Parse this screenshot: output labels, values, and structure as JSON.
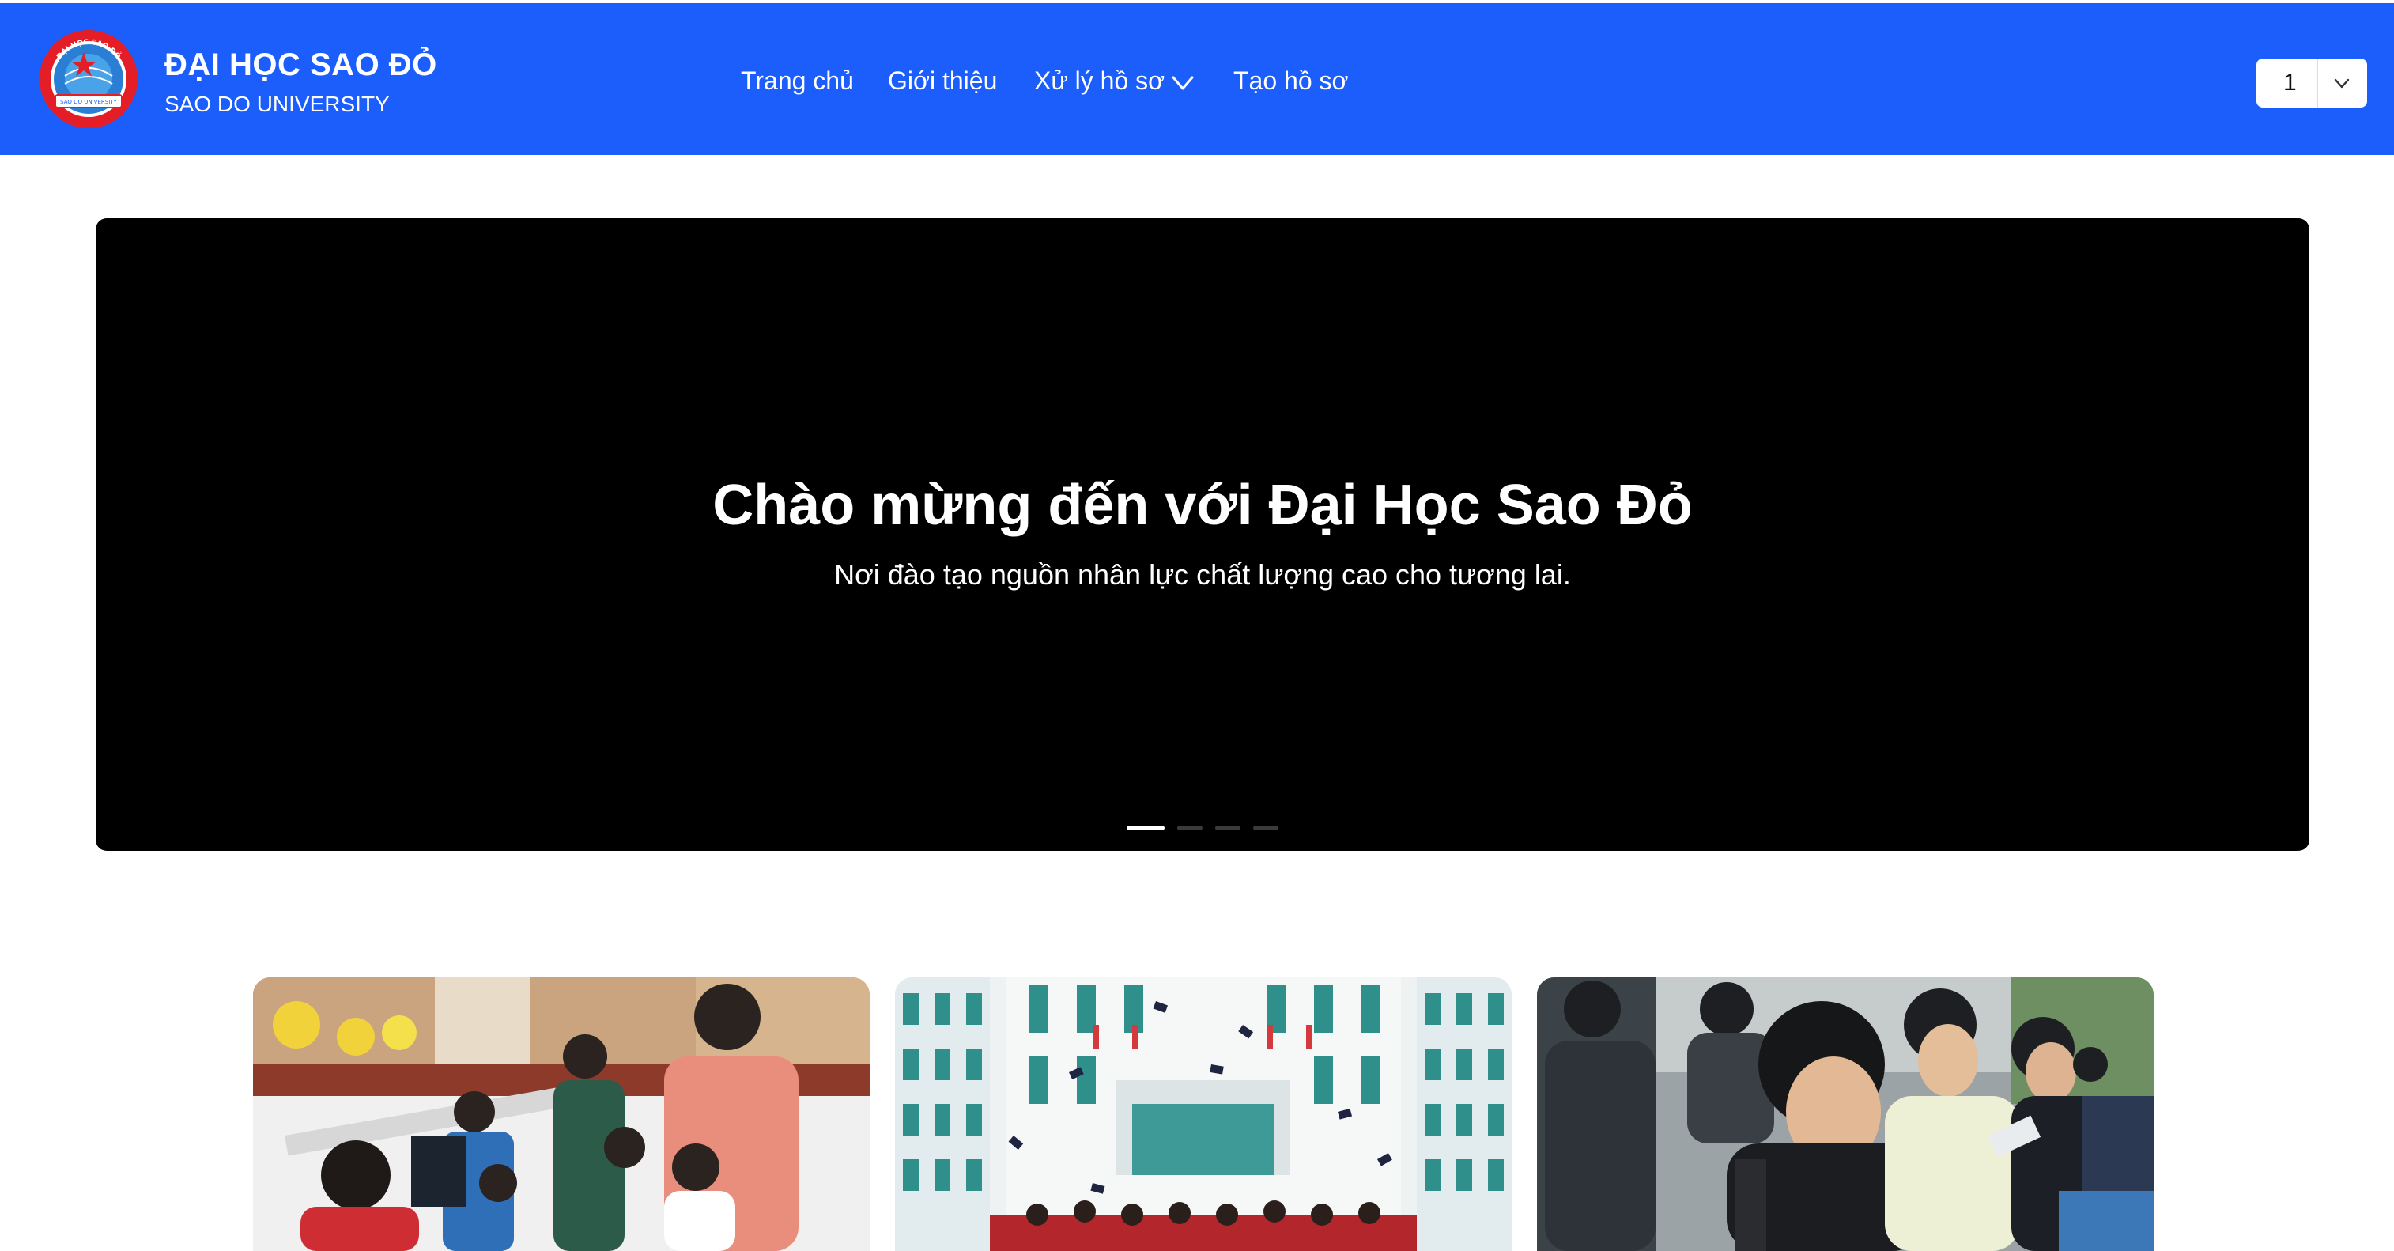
{
  "brand": {
    "title": "ĐẠI HỌC SAO ĐỎ",
    "subtitle": "SAO DO UNIVERSITY",
    "logo_ring_text": "ĐẠI HỌC SAO ĐỎ",
    "logo_ribbon_text": "SAO DO UNIVERSITY"
  },
  "nav": {
    "items": [
      {
        "label": "Trang chủ"
      },
      {
        "label": "Giới thiệu"
      },
      {
        "label": "Xử lý hồ sơ"
      },
      {
        "label": "Tạo hồ sơ"
      }
    ],
    "dropdown_icon": "chevron-down-icon"
  },
  "selector": {
    "value": "1",
    "icon": "chevron-down-icon"
  },
  "hero": {
    "title": "Chào mừng đến với Đại Học Sao Đỏ",
    "subtitle": "Nơi đào tạo nguồn nhân lực chất lượng cao cho tương lai.",
    "slide_count": 4,
    "active_slide": 1
  },
  "colors": {
    "header_bg": "#1b5efc",
    "hero_bg": "#000000",
    "logo_red": "#e41e26",
    "logo_blue": "#2a7fd4"
  },
  "cards": [
    {
      "image": "admission-registration-photo"
    },
    {
      "image": "graduation-building-photo"
    },
    {
      "image": "students-studying-photo"
    }
  ]
}
